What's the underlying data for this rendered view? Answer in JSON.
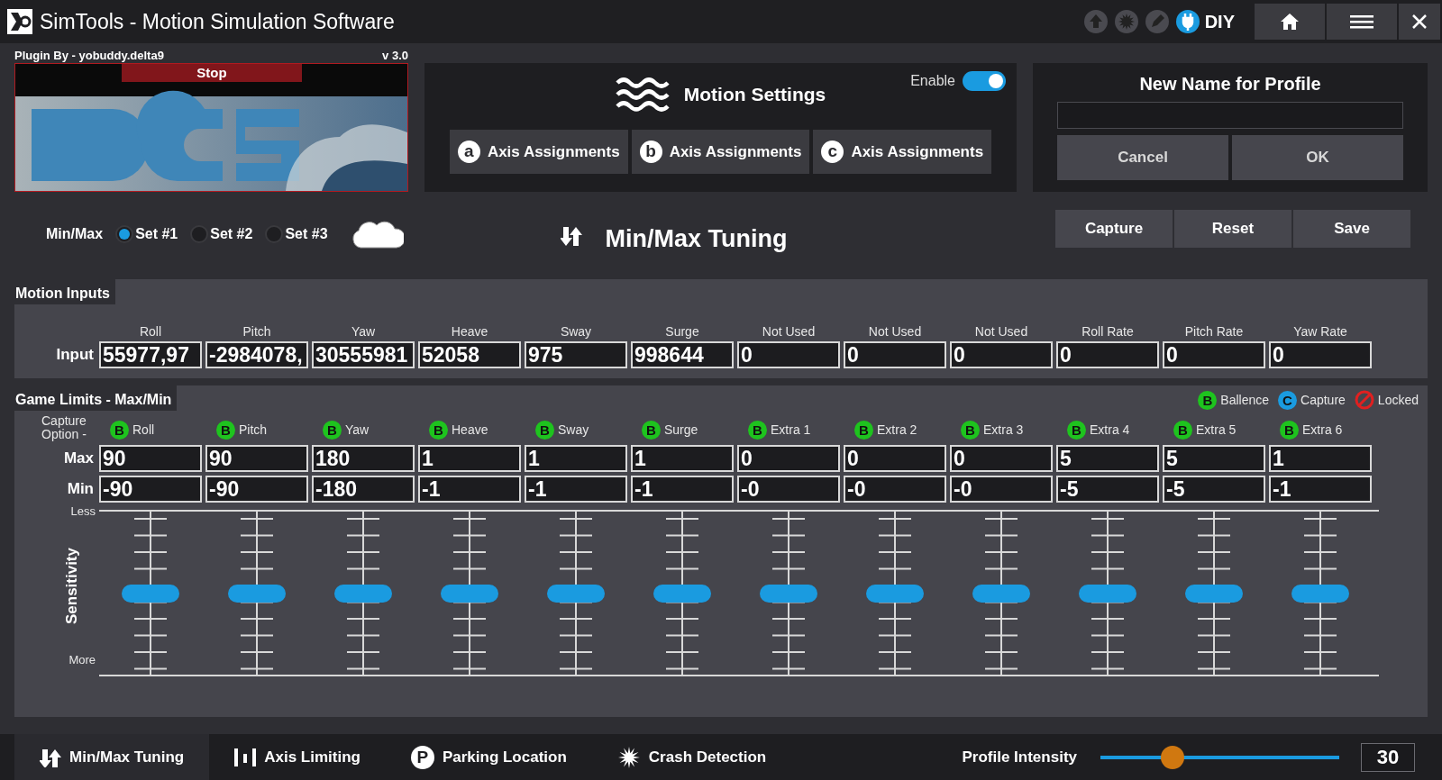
{
  "window": {
    "title": "SimTools - Motion Simulation Software"
  },
  "title_bar": {
    "tools": [
      {
        "kind": "upload",
        "active": false
      },
      {
        "kind": "burst",
        "active": false
      },
      {
        "kind": "pencil",
        "active": false
      },
      {
        "kind": "plug",
        "active": true
      }
    ],
    "mode": "DIY"
  },
  "plugin": {
    "credit": "Plugin By - yobuddy.delta9",
    "version": "v 3.0",
    "stop_button": "Stop"
  },
  "motion_settings": {
    "title": "Motion Settings",
    "enable": {
      "label": "Enable",
      "on": true
    },
    "axis_buttons": [
      {
        "letter": "a",
        "label": "Axis Assignments"
      },
      {
        "letter": "b",
        "label": "Axis Assignments"
      },
      {
        "letter": "c",
        "label": "Axis Assignments"
      }
    ]
  },
  "profile": {
    "title": "New Name for Profile",
    "buttons": [
      "Cancel",
      "OK"
    ]
  },
  "minmax": {
    "label": "Min/Max",
    "sets": [
      {
        "label": "Set #1",
        "selected": true
      },
      {
        "label": "Set #2",
        "selected": false
      },
      {
        "label": "Set #3",
        "selected": false
      }
    ],
    "title": "Min/Max Tuning",
    "buttons": [
      "Capture",
      "Reset",
      "Save"
    ]
  },
  "motion_inputs": {
    "title": "Motion Inputs",
    "row_label": "Input",
    "columns": [
      {
        "name": "Roll",
        "value": "55977,97"
      },
      {
        "name": "Pitch",
        "value": "-2984078,"
      },
      {
        "name": "Yaw",
        "value": "30555981"
      },
      {
        "name": "Heave",
        "value": "52058"
      },
      {
        "name": "Sway",
        "value": "975"
      },
      {
        "name": "Surge",
        "value": "998644"
      },
      {
        "name": "Not Used",
        "value": "0"
      },
      {
        "name": "Not Used",
        "value": "0"
      },
      {
        "name": "Not Used",
        "value": "0"
      },
      {
        "name": "Roll Rate",
        "value": "0"
      },
      {
        "name": "Pitch Rate",
        "value": "0"
      },
      {
        "name": "Yaw Rate",
        "value": "0"
      }
    ]
  },
  "game_limits": {
    "title": "Game Limits - Max/Min",
    "legend": [
      {
        "kind": "letter",
        "symbol": "B",
        "label": "Ballence",
        "color": "#1ec31e"
      },
      {
        "kind": "letter",
        "symbol": "C",
        "label": "Capture",
        "color": "#1a9be0"
      },
      {
        "kind": "locked",
        "label": "Locked",
        "color": "#e02020"
      }
    ],
    "capture_label": "Capture Option -",
    "max_label": "Max",
    "min_label": "Min",
    "sensitivity_label": "Sensitivity",
    "less_label": "Less",
    "more_label": "More",
    "columns": [
      {
        "name": "Roll",
        "option": "B",
        "color": "#1ec31e",
        "max": "90",
        "min": "-90",
        "level": 0.5
      },
      {
        "name": "Pitch",
        "option": "B",
        "color": "#1ec31e",
        "max": "90",
        "min": "-90",
        "level": 0.5
      },
      {
        "name": "Yaw",
        "option": "B",
        "color": "#1ec31e",
        "max": "180",
        "min": "-180",
        "level": 0.5
      },
      {
        "name": "Heave",
        "option": "B",
        "color": "#1ec31e",
        "max": "1",
        "min": "-1",
        "level": 0.5
      },
      {
        "name": "Sway",
        "option": "B",
        "color": "#1ec31e",
        "max": "1",
        "min": "-1",
        "level": 0.5
      },
      {
        "name": "Surge",
        "option": "B",
        "color": "#1ec31e",
        "max": "1",
        "min": "-1",
        "level": 0.5
      },
      {
        "name": "Extra 1",
        "option": "B",
        "color": "#1ec31e",
        "max": "0",
        "min": "-0",
        "level": 0.5
      },
      {
        "name": "Extra 2",
        "option": "B",
        "color": "#1ec31e",
        "max": "0",
        "min": "-0",
        "level": 0.5
      },
      {
        "name": "Extra 3",
        "option": "B",
        "color": "#1ec31e",
        "max": "0",
        "min": "-0",
        "level": 0.5
      },
      {
        "name": "Extra 4",
        "option": "B",
        "color": "#1ec31e",
        "max": "5",
        "min": "-5",
        "level": 0.5
      },
      {
        "name": "Extra 5",
        "option": "B",
        "color": "#1ec31e",
        "max": "5",
        "min": "-5",
        "level": 0.5
      },
      {
        "name": "Extra 6",
        "option": "B",
        "color": "#1ec31e",
        "max": "1",
        "min": "-1",
        "level": 0.5
      }
    ]
  },
  "bottom_tabs": [
    {
      "kind": "arrows",
      "label": "Min/Max Tuning",
      "selected": true
    },
    {
      "kind": "bars",
      "label": "Axis Limiting",
      "selected": false
    },
    {
      "kind": "badge",
      "badge": "P",
      "label": "Parking Location",
      "selected": false
    },
    {
      "kind": "burst",
      "label": "Crash Detection",
      "selected": false
    }
  ],
  "intensity": {
    "label": "Profile Intensity",
    "level": 0.3,
    "value": "30"
  }
}
